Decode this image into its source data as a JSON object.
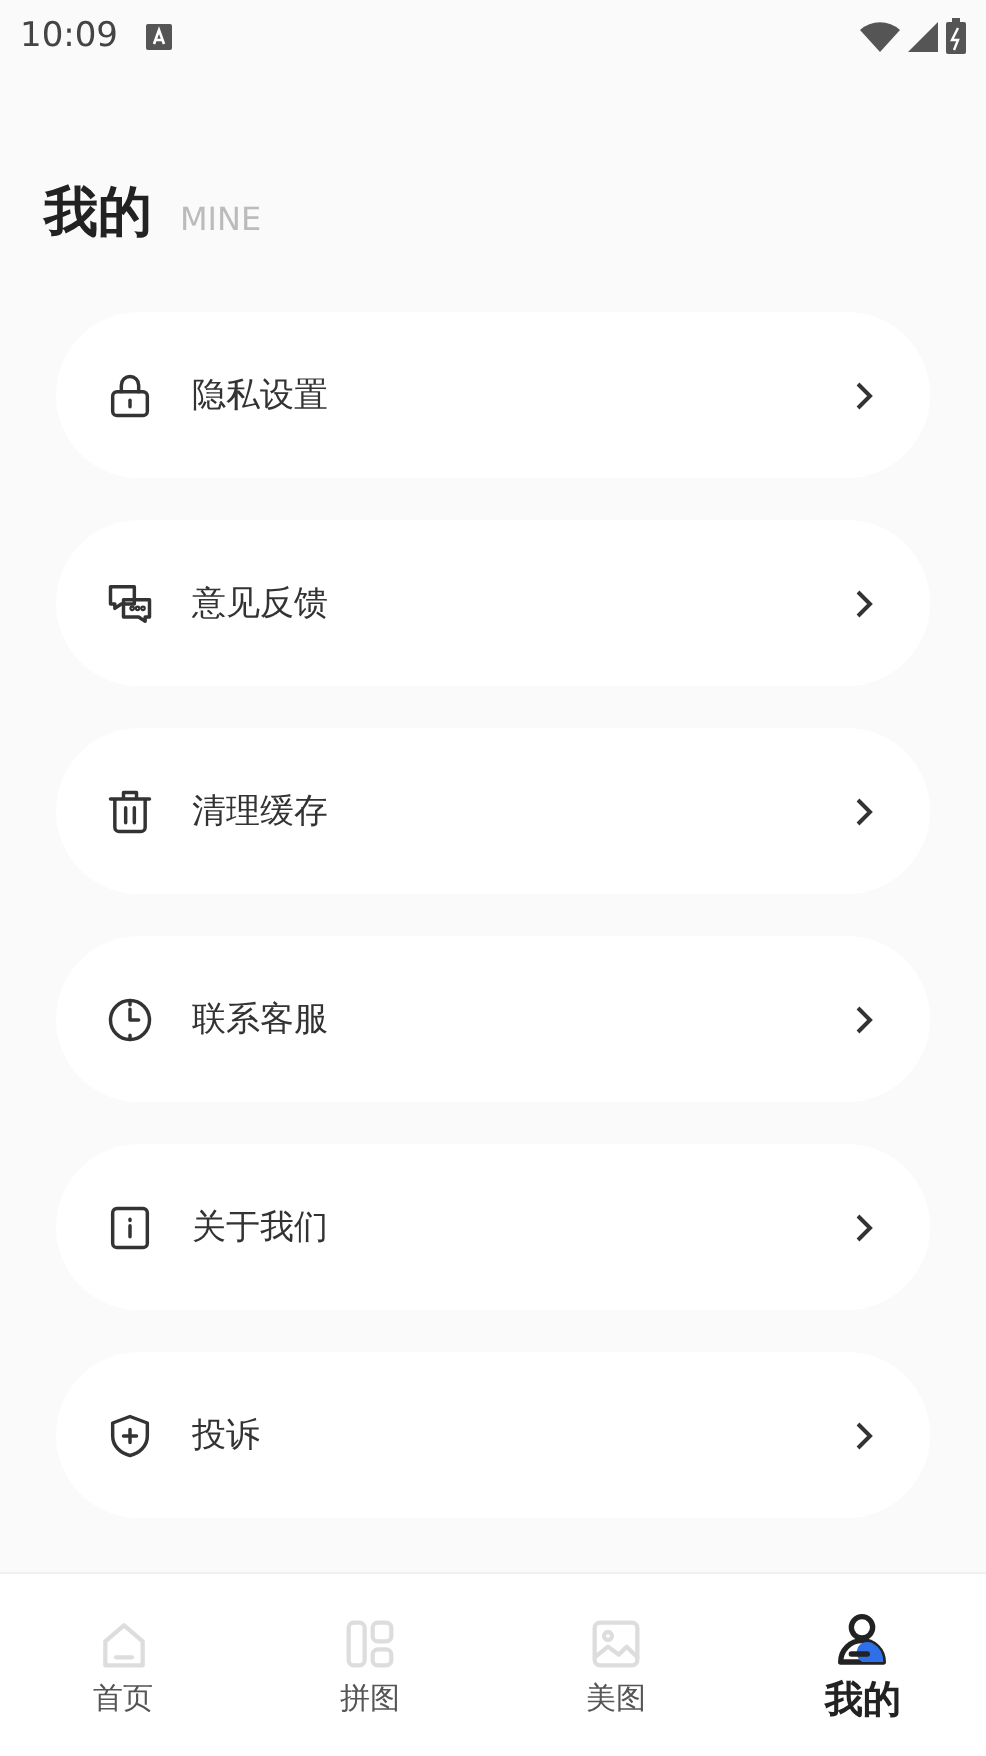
{
  "status_bar": {
    "time": "10:09"
  },
  "header": {
    "title": "我的",
    "subtitle": "MINE"
  },
  "menu": [
    {
      "kind": "lock",
      "label": "隐私设置"
    },
    {
      "kind": "chat",
      "label": "意见反馈"
    },
    {
      "kind": "trash",
      "label": "清理缓存"
    },
    {
      "kind": "clock",
      "label": "联系客服"
    },
    {
      "kind": "info",
      "label": "关于我们"
    },
    {
      "kind": "shield",
      "label": "投诉"
    }
  ],
  "tabs": [
    {
      "kind": "home",
      "label": "首页",
      "selected": false
    },
    {
      "kind": "grid",
      "label": "拼图",
      "selected": false
    },
    {
      "kind": "image",
      "label": "美图",
      "selected": false
    },
    {
      "kind": "user",
      "label": "我的",
      "selected": true
    }
  ]
}
